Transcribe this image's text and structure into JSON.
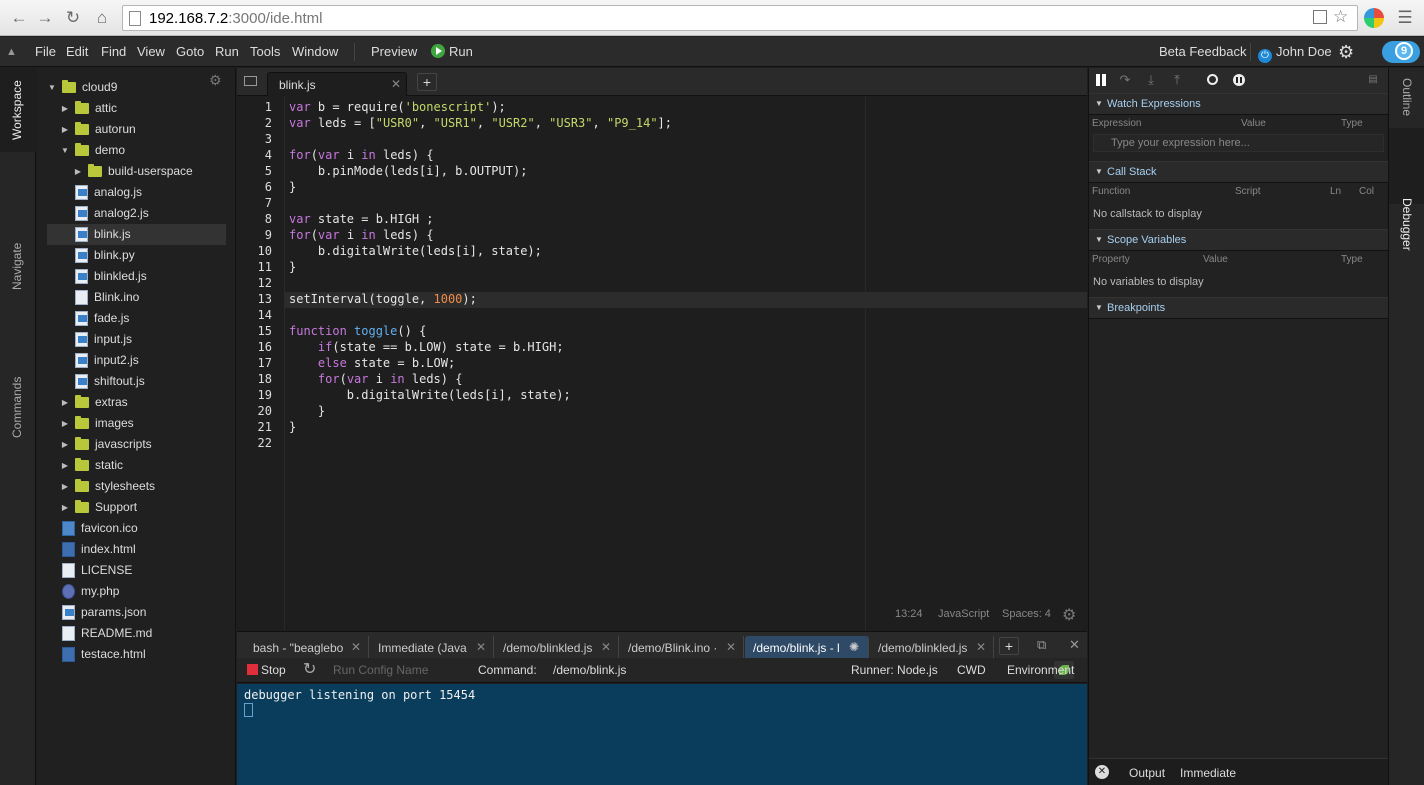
{
  "browser": {
    "url_host": "192.168.7.2",
    "url_rest": ":3000/ide.html"
  },
  "menubar": {
    "items": [
      "File",
      "Edit",
      "Find",
      "View",
      "Goto",
      "Run",
      "Tools",
      "Window"
    ],
    "preview": "Preview",
    "run": "Run",
    "beta_feedback": "Beta Feedback",
    "user": "John Doe",
    "cloud_badge": "9"
  },
  "left_tabs": [
    "Workspace",
    "Navigate",
    "Commands"
  ],
  "right_tabs": [
    "Outline",
    "Debugger"
  ],
  "tree": [
    {
      "name": "cloud9",
      "type": "folder",
      "depth": 0,
      "open": true
    },
    {
      "name": "attic",
      "type": "folder",
      "depth": 1,
      "open": false
    },
    {
      "name": "autorun",
      "type": "folder",
      "depth": 1,
      "open": false
    },
    {
      "name": "demo",
      "type": "folder",
      "depth": 1,
      "open": true
    },
    {
      "name": "build-userspace",
      "type": "folder",
      "depth": 2,
      "open": false
    },
    {
      "name": "analog.js",
      "type": "js",
      "depth": 2
    },
    {
      "name": "analog2.js",
      "type": "js",
      "depth": 2
    },
    {
      "name": "blink.js",
      "type": "js",
      "depth": 2,
      "selected": true
    },
    {
      "name": "blink.py",
      "type": "js",
      "depth": 2
    },
    {
      "name": "blinkled.js",
      "type": "js",
      "depth": 2
    },
    {
      "name": "Blink.ino",
      "type": "doc",
      "depth": 2
    },
    {
      "name": "fade.js",
      "type": "js",
      "depth": 2
    },
    {
      "name": "input.js",
      "type": "js",
      "depth": 2
    },
    {
      "name": "input2.js",
      "type": "js",
      "depth": 2
    },
    {
      "name": "shiftout.js",
      "type": "js",
      "depth": 2
    },
    {
      "name": "extras",
      "type": "folder",
      "depth": 1,
      "open": false
    },
    {
      "name": "images",
      "type": "folder",
      "depth": 1,
      "open": false
    },
    {
      "name": "javascripts",
      "type": "folder",
      "depth": 1,
      "open": false
    },
    {
      "name": "static",
      "type": "folder",
      "depth": 1,
      "open": false
    },
    {
      "name": "stylesheets",
      "type": "folder",
      "depth": 1,
      "open": false
    },
    {
      "name": "Support",
      "type": "folder",
      "depth": 1,
      "open": false
    },
    {
      "name": "favicon.ico",
      "type": "img",
      "depth": 1
    },
    {
      "name": "index.html",
      "type": "html",
      "depth": 1
    },
    {
      "name": "LICENSE",
      "type": "doc",
      "depth": 1
    },
    {
      "name": "my.php",
      "type": "php",
      "depth": 1
    },
    {
      "name": "params.json",
      "type": "js",
      "depth": 1
    },
    {
      "name": "README.md",
      "type": "doc",
      "depth": 1
    },
    {
      "name": "testace.html",
      "type": "html",
      "depth": 1
    }
  ],
  "editor": {
    "tab_label": "blink.js",
    "lines": [
      "var b = require('bonescript');",
      "var leds = [\"USR0\", \"USR1\", \"USR2\", \"USR3\", \"P9_14\"];",
      "",
      "for(var i in leds) {",
      "    b.pinMode(leds[i], b.OUTPUT);",
      "}",
      "",
      "var state = b.HIGH ;",
      "for(var i in leds) {",
      "    b.digitalWrite(leds[i], state);",
      "}",
      "",
      "setInterval(toggle, 1000);",
      "",
      "function toggle() {",
      "    if(state == b.LOW) state = b.HIGH;",
      "    else state = b.LOW;",
      "    for(var i in leds) {",
      "        b.digitalWrite(leds[i], state);",
      "    }",
      "}",
      ""
    ],
    "active_line": 13,
    "status": {
      "position": "13:24",
      "mode": "JavaScript",
      "spaces": "Spaces: 4"
    }
  },
  "console": {
    "tabs": [
      "bash - \"beaglebo",
      "Immediate (Java",
      "/demo/blinkled.js",
      "/demo/Blink.ino ·",
      "/demo/blink.js - l",
      "/demo/blinkled.js"
    ],
    "active_tab": 4,
    "stop": "Stop",
    "run_config_placeholder": "Run Config Name",
    "command_label": "Command:",
    "command_value": "/demo/blink.js",
    "runner": "Runner: Node.js",
    "cwd": "CWD",
    "environment": "Environment",
    "output": "debugger listening on port 15454"
  },
  "debugger": {
    "watch": {
      "title": "Watch Expressions",
      "cols": [
        "Expression",
        "Value",
        "Type"
      ],
      "placeholder": "Type your expression here..."
    },
    "callstack": {
      "title": "Call Stack",
      "cols": [
        "Function",
        "Script",
        "Ln",
        "Col"
      ],
      "empty": "No callstack to display"
    },
    "scope": {
      "title": "Scope Variables",
      "cols": [
        "Property",
        "Value",
        "Type"
      ],
      "empty": "No variables to display"
    },
    "breakpoints": {
      "title": "Breakpoints"
    },
    "bottom": {
      "output": "Output",
      "immediate": "Immediate"
    }
  }
}
